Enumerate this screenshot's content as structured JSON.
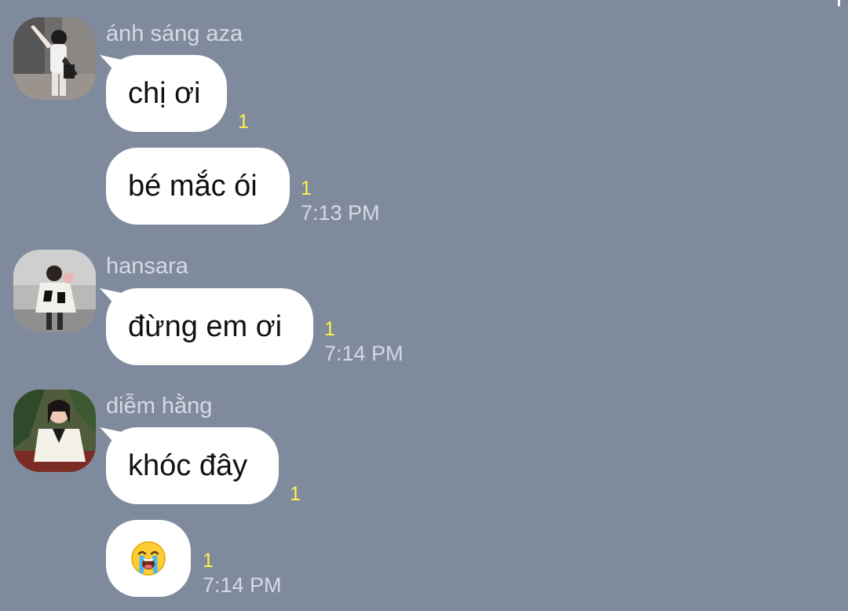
{
  "chat": {
    "groups": [
      {
        "sender": "ánh sáng aza",
        "messages": [
          {
            "text": "chị ơi",
            "unread": "1",
            "time": ""
          },
          {
            "text": "bé mắc ói",
            "unread": "1",
            "time": "7:13 PM"
          }
        ]
      },
      {
        "sender": "hansara",
        "messages": [
          {
            "text": "đừng em ơi",
            "unread": "1",
            "time": "7:14 PM"
          }
        ]
      },
      {
        "sender": "diễm hằng",
        "messages": [
          {
            "text": "khóc đây",
            "unread": "1",
            "time": ""
          },
          {
            "emoji": "loudly-crying-face-icon",
            "unread": "1",
            "time": "7:14 PM"
          }
        ]
      }
    ]
  },
  "colors": {
    "background": "#808a9d",
    "bubble": "#ffffff",
    "unread_badge": "#fff24a",
    "meta_text": "#d5dae3"
  }
}
